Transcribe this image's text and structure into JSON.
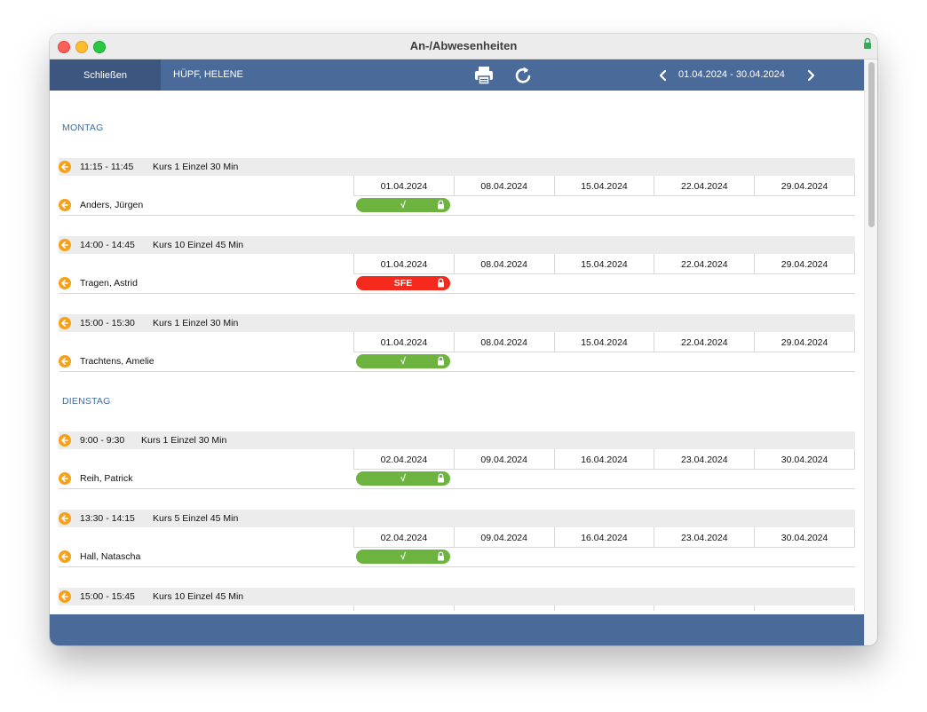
{
  "window": {
    "title": "An-/Abwesenheiten"
  },
  "toolbar": {
    "close_label": "Schließen",
    "student_name": "HÜPF, HELENE",
    "date_range": "01.04.2024 - 30.04.2024",
    "print_icon": "print-icon",
    "refresh_icon": "refresh-icon"
  },
  "colors": {
    "header_blue": "#4a6a9a",
    "present_green": "#6cb33f",
    "absent_red": "#f5291c",
    "day_label": "#3b6ea5",
    "accent_orange": "#f5a11c"
  },
  "days": [
    {
      "label": "MONTAG",
      "courses": [
        {
          "time": "11:15 - 11:45",
          "name": "Kurs 1 Einzel 30 Min",
          "dates": [
            "01.04.2024",
            "08.04.2024",
            "15.04.2024",
            "22.04.2024",
            "29.04.2024"
          ],
          "students": [
            {
              "name": "Anders, Jürgen",
              "status": "√",
              "status_color": "#6cb33f"
            }
          ]
        },
        {
          "time": "14:00 - 14:45",
          "name": "Kurs 10 Einzel 45 Min",
          "dates": [
            "01.04.2024",
            "08.04.2024",
            "15.04.2024",
            "22.04.2024",
            "29.04.2024"
          ],
          "students": [
            {
              "name": "Tragen, Astrid",
              "status": "SFE",
              "status_color": "#f5291c"
            }
          ]
        },
        {
          "time": "15:00 - 15:30",
          "name": "Kurs 1 Einzel 30 Min",
          "dates": [
            "01.04.2024",
            "08.04.2024",
            "15.04.2024",
            "22.04.2024",
            "29.04.2024"
          ],
          "students": [
            {
              "name": "Trachtens, Amelie",
              "status": "√",
              "status_color": "#6cb33f"
            }
          ]
        }
      ]
    },
    {
      "label": "DIENSTAG",
      "courses": [
        {
          "time": "9:00 - 9:30",
          "name": "Kurs 1 Einzel 30 Min",
          "dates": [
            "02.04.2024",
            "09.04.2024",
            "16.04.2024",
            "23.04.2024",
            "30.04.2024"
          ],
          "students": [
            {
              "name": "Reih, Patrick",
              "status": "√",
              "status_color": "#6cb33f"
            }
          ]
        },
        {
          "time": "13:30 - 14:15",
          "name": "Kurs 5 Einzel 45 Min",
          "dates": [
            "02.04.2024",
            "09.04.2024",
            "16.04.2024",
            "23.04.2024",
            "30.04.2024"
          ],
          "students": [
            {
              "name": "Hall, Natascha",
              "status": "√",
              "status_color": "#6cb33f"
            }
          ]
        },
        {
          "time": "15:00 - 15:45",
          "name": "Kurs 10 Einzel 45 Min",
          "dates": [],
          "students": []
        }
      ]
    }
  ]
}
